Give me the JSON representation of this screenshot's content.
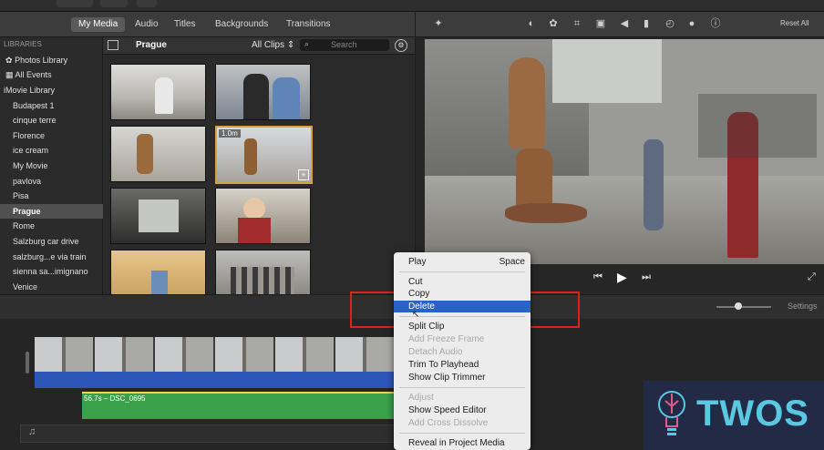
{
  "tabs": [
    "My Media",
    "Audio",
    "Titles",
    "Backgrounds",
    "Transitions"
  ],
  "viewer": {
    "reset_all": "Reset All"
  },
  "sidebar": {
    "libraries_heading": "LIBRARIES",
    "items": [
      "Photos Library",
      "All Events",
      "iMovie Library",
      "Budapest 1",
      "cinque terre",
      "Florence",
      "ice cream",
      "My Movie",
      "pavlova",
      "Pisa",
      "Prague",
      "Rome",
      "Salzburg car drive",
      "salzburg...e via train",
      "sienna sa...imignano",
      "Venice"
    ],
    "selected": "Prague"
  },
  "browser": {
    "event_title": "Prague",
    "filter": "All Clips",
    "search_placeholder": "Search",
    "selected_clip_duration": "1.0m"
  },
  "timeline": {
    "clip_label": "56.7s – DSC_0695",
    "settings_label": "Settings"
  },
  "context_menu": {
    "items": [
      {
        "label": "Play",
        "shortcut": "Space",
        "enabled": true
      },
      {
        "label": "Cut",
        "enabled": true
      },
      {
        "label": "Copy",
        "enabled": true
      },
      {
        "label": "Delete",
        "enabled": true,
        "highlighted": true
      },
      {
        "label": "Split Clip",
        "enabled": true
      },
      {
        "label": "Add Freeze Frame",
        "enabled": false
      },
      {
        "label": "Detach Audio",
        "enabled": false
      },
      {
        "label": "Trim To Playhead",
        "enabled": true
      },
      {
        "label": "Show Clip Trimmer",
        "enabled": true
      },
      {
        "label": "Adjust",
        "enabled": false
      },
      {
        "label": "Show Speed Editor",
        "enabled": true
      },
      {
        "label": "Add Cross Dissolve",
        "enabled": false
      },
      {
        "label": "Reveal in Project Media",
        "enabled": true
      }
    ]
  },
  "watermark": {
    "brand": "TWOS"
  },
  "colors": {
    "accent": "#2a63c8",
    "selection": "#d8a13a",
    "highlight_box": "#e02020",
    "audio_track": "#3aa14a",
    "video_track": "#2c57b8"
  }
}
